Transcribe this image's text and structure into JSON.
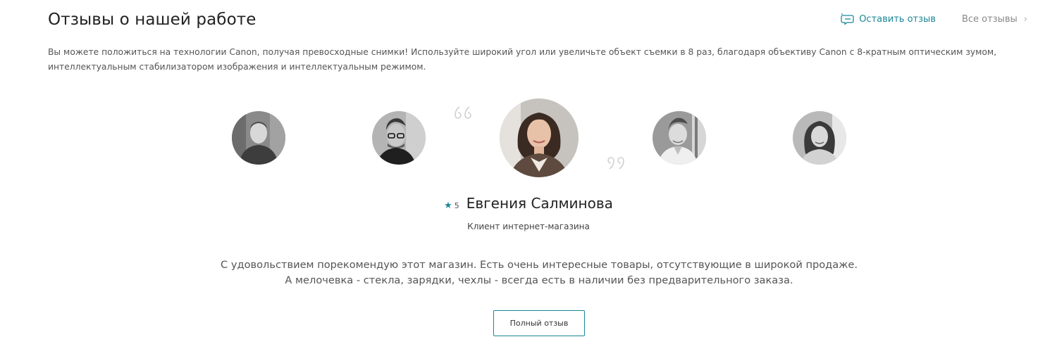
{
  "header": {
    "title": "Отзывы о нашей работе",
    "leave_review_label": "Оставить отзыв",
    "all_reviews_label": "Все отзывы",
    "leave_review_icon": "review-bubble-icon",
    "all_reviews_icon": "chevron-right-icon"
  },
  "description": "Вы можете положиться на технологии Canon, получая превосходные снимки! Используйте широкий угол или увеличьте объект съемки в 8 раз, благодаря объективу Canon с 8-кратным оптическим зумом, интеллектуальным стабилизатором изображения и интеллектуальным режимом.",
  "avatars": [
    {
      "icon": "person-avatar-icon",
      "active": false
    },
    {
      "icon": "person-avatar-icon",
      "active": false
    },
    {
      "icon": "person-avatar-icon",
      "active": true
    },
    {
      "icon": "person-avatar-icon",
      "active": false
    },
    {
      "icon": "person-avatar-icon",
      "active": false
    }
  ],
  "review": {
    "rating": "5",
    "star_icon": "star-icon",
    "name": "Евгения Салминова",
    "role": "Клиент интернет-магазина",
    "text_line1": "С удовольствием порекомендую этот магазин. Есть очень интересные товары, отсутствующие в широкой продаже.",
    "text_line2": "А мелочевка - стекла, зарядки, чехлы - всегда есть в наличии без предварительного заказа.",
    "full_button_label": "Полный отзыв"
  },
  "colors": {
    "accent": "#1b8796",
    "quote_mark": "#d0d0d0"
  }
}
